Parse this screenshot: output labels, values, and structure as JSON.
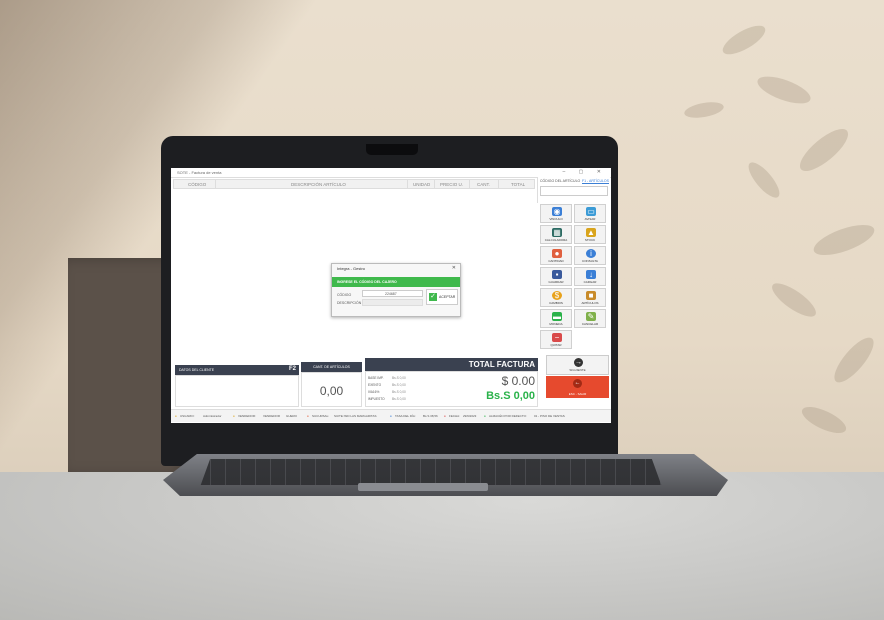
{
  "window": {
    "title": "SOTE - Factura de venta",
    "controls": "–  ▢  ✕"
  },
  "table_header": {
    "codigo": "CÓDIGO",
    "descripcion": "DESCRIPCIÓN ARTÍCULO",
    "unidad": "UNIDAD",
    "precio": "PRECIO U.",
    "cant": "CANT.",
    "total": "TOTAL"
  },
  "sidebar": {
    "codigo_label": "CÓDIGO DEL ARTÍCULO",
    "f1_link": "F1 - ARTÍCULOS",
    "tiles": [
      {
        "label": "VINCULO",
        "icon": "chat-icon",
        "color": "#3b7fd6"
      },
      {
        "label": "AVISAR",
        "icon": "monitor-icon",
        "color": "#3b9bd6"
      },
      {
        "label": "CALCULADORA",
        "icon": "calculator-icon",
        "color": "#2c6b63"
      },
      {
        "label": "STOCK",
        "icon": "stock-icon",
        "color": "#d9a41c"
      },
      {
        "label": "CANTIDAD",
        "icon": "quantity-icon",
        "color": "#e0603f"
      },
      {
        "label": "CONSULTA",
        "icon": "info-icon",
        "color": "#3b7fd6"
      },
      {
        "label": "GUARDAR",
        "icon": "save-icon",
        "color": "#3a5a9c"
      },
      {
        "label": "CARGAR",
        "icon": "download-icon",
        "color": "#3b7fd6"
      },
      {
        "label": "CAMBIOS",
        "icon": "coins-icon",
        "color": "#e8a21c"
      },
      {
        "label": "ARTÍCULOS",
        "icon": "box-icon",
        "color": "#c88b2a"
      },
      {
        "label": "MONEDA",
        "icon": "money-icon",
        "color": "#2ab24a"
      },
      {
        "label": "CANCELAR",
        "icon": "cancel-icon",
        "color": "#7fb04a"
      },
      {
        "label": "QUITAR",
        "icon": "remove-icon",
        "color": "#d94a4a"
      }
    ],
    "siguiente": "SIGUIENTE",
    "salir": "ESC - SALIR"
  },
  "client": {
    "title": "DATOS DEL CLIENTE",
    "shortcut": "F2"
  },
  "cantidad": {
    "title": "CANT. DE ARTÍCULOS",
    "value": "0,00"
  },
  "total": {
    "title": "TOTAL FACTURA",
    "rows": [
      {
        "label": "BASE IMP.",
        "value": "Bs.S 0,00"
      },
      {
        "label": "EXENTO",
        "value": "Bs.S 0,00"
      },
      {
        "label": "IVA16%",
        "value": "Bs.S 0,00"
      },
      {
        "label": "IMPUESTO",
        "value": "Bs.S 0,00"
      }
    ],
    "usd": "$ 0.00",
    "ves": "Bs.S 0,00"
  },
  "status_bar": {
    "usuario_label": "USUARIO:",
    "usuario": "Administrador",
    "vendedor_label": "VENDEDOR:",
    "vendedor": "VENDEDOR",
    "vendedor2": "GUERO",
    "sucursal_label": "SUCURSAL:",
    "sucursal": "SUITE ISID LAS MARGARITAS",
    "tasa_label": "TASA DEL DÍA:",
    "tasa": "Bs.S 38,56",
    "fecha_label": "FECHA:",
    "fecha": "29/9/2023",
    "almacen_label": "ALMACÉN POR DEFECTO:",
    "almacen": "01 - PISO DE VENTAS"
  },
  "dialog": {
    "title": "Integra - Gestro",
    "close": "✕",
    "banner": "INGRESE EL CÓDIGO DEL CAJERO",
    "codigo_label": "CÓDIGO",
    "codigo_value": "224687",
    "descripcion_label": "DESCRIPCIÓN",
    "ok_label": "ACEPTAR"
  }
}
